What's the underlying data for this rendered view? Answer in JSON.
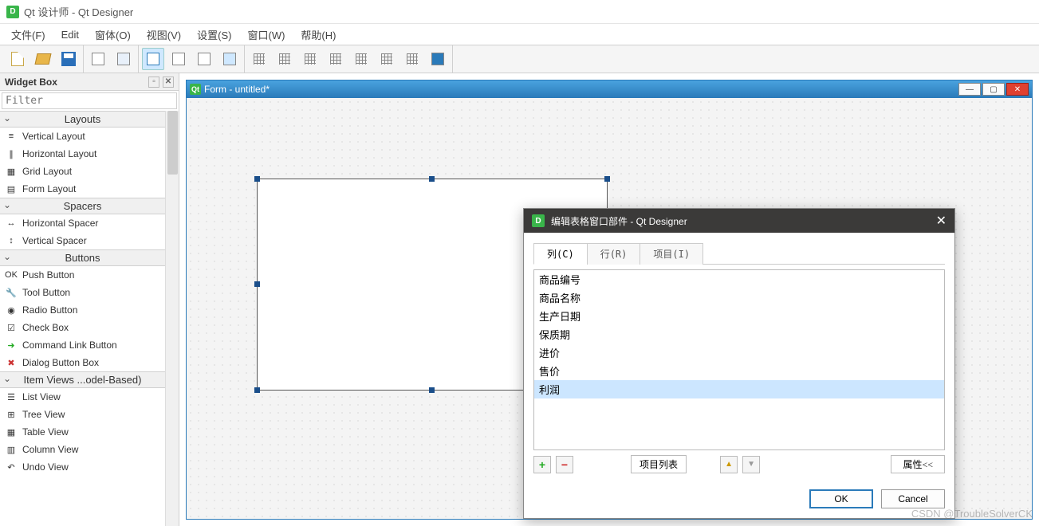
{
  "title": "Qt 设计师 - Qt Designer",
  "menus": [
    "文件(F)",
    "Edit",
    "窗体(O)",
    "视图(V)",
    "设置(S)",
    "窗口(W)",
    "帮助(H)"
  ],
  "widgetbox": {
    "title": "Widget Box",
    "filter_placeholder": "Filter",
    "categories": [
      {
        "name": "Layouts",
        "items": [
          "Vertical Layout",
          "Horizontal Layout",
          "Grid Layout",
          "Form Layout"
        ]
      },
      {
        "name": "Spacers",
        "items": [
          "Horizontal Spacer",
          "Vertical Spacer"
        ]
      },
      {
        "name": "Buttons",
        "items": [
          "Push Button",
          "Tool Button",
          "Radio Button",
          "Check Box",
          "Command Link Button",
          "Dialog Button Box"
        ]
      },
      {
        "name": "Item Views ...odel-Based)",
        "items": [
          "List View",
          "Tree View",
          "Table View",
          "Column View",
          "Undo View"
        ]
      }
    ]
  },
  "form": {
    "title": "Form - untitled*"
  },
  "dialog": {
    "title": "编辑表格窗口部件 - Qt Designer",
    "tabs": [
      "列(C)",
      "行(R)",
      "项目(I)"
    ],
    "active_tab": 0,
    "columns": [
      "商品编号",
      "商品名称",
      "生产日期",
      "保质期",
      "进价",
      "售价",
      "利润"
    ],
    "selected_index": 6,
    "item_list_label": "项目列表",
    "props_label": "属性<<",
    "ok": "OK",
    "cancel": "Cancel"
  },
  "watermark": "CSDN @TroubleSolverCK"
}
